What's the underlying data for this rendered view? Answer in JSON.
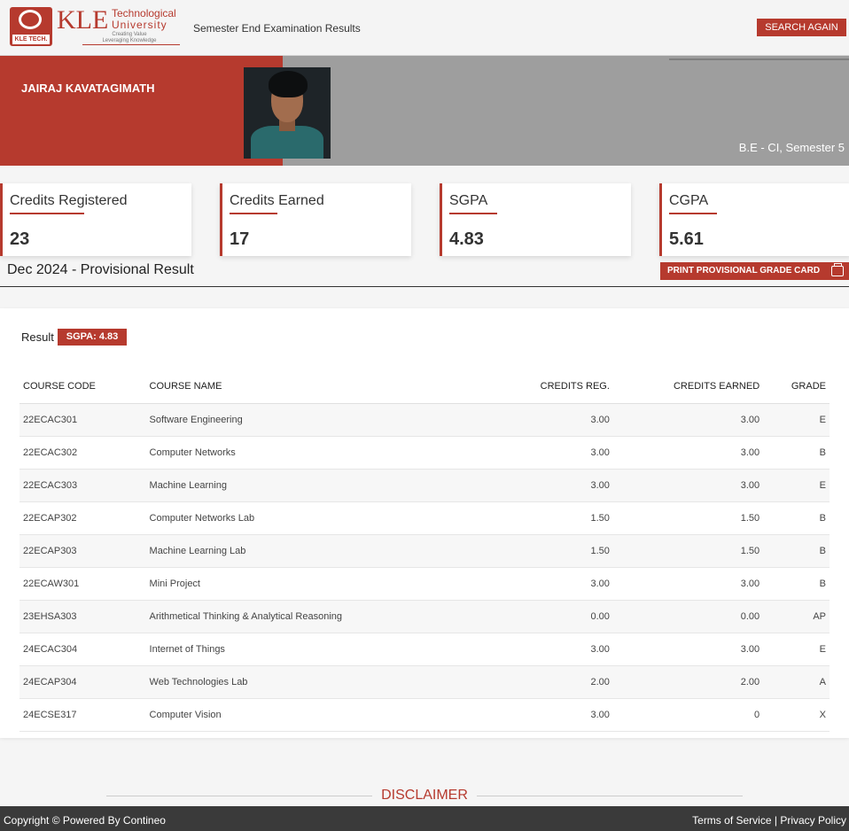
{
  "header": {
    "logo": {
      "name": "KLE",
      "subtitle_line1": "Technological",
      "subtitle_line2": "University",
      "tagline_line1": "Creating Value",
      "tagline_line2": "Leveraging Knowledge",
      "badge": "KLE TECH."
    },
    "title": "Semester End Examination Results",
    "search_again_label": "SEARCH AGAIN"
  },
  "student": {
    "name": "JAIRAJ KAVATAGIMATH",
    "program": "B.E - CI, Semester 5"
  },
  "stats": [
    {
      "label": "Credits Registered",
      "value": "23"
    },
    {
      "label": "Credits Earned",
      "value": "17"
    },
    {
      "label": "SGPA",
      "value": "4.83"
    },
    {
      "label": "CGPA",
      "value": "5.61"
    }
  ],
  "result_title": "Dec 2024 - Provisional Result",
  "print_label": "PRINT PROVISIONAL GRADE CARD",
  "result": {
    "label": "Result",
    "sgpa_badge": "SGPA: 4.83",
    "columns": [
      "COURSE CODE",
      "COURSE NAME",
      "CREDITS REG.",
      "CREDITS EARNED",
      "GRADE"
    ],
    "rows": [
      {
        "code": "22ECAC301",
        "name": "Software Engineering",
        "reg": "3.00",
        "earned": "3.00",
        "grade": "E"
      },
      {
        "code": "22ECAC302",
        "name": "Computer Networks",
        "reg": "3.00",
        "earned": "3.00",
        "grade": "B"
      },
      {
        "code": "22ECAC303",
        "name": "Machine Learning",
        "reg": "3.00",
        "earned": "3.00",
        "grade": "E"
      },
      {
        "code": "22ECAP302",
        "name": "Computer Networks Lab",
        "reg": "1.50",
        "earned": "1.50",
        "grade": "B"
      },
      {
        "code": "22ECAP303",
        "name": "Machine Learning Lab",
        "reg": "1.50",
        "earned": "1.50",
        "grade": "B"
      },
      {
        "code": "22ECAW301",
        "name": "Mini Project",
        "reg": "3.00",
        "earned": "3.00",
        "grade": "B"
      },
      {
        "code": "23EHSA303",
        "name": "Arithmetical Thinking & Analytical Reasoning",
        "reg": "0.00",
        "earned": "0.00",
        "grade": "AP"
      },
      {
        "code": "24ECAC304",
        "name": "Internet of Things",
        "reg": "3.00",
        "earned": "3.00",
        "grade": "E"
      },
      {
        "code": "24ECAP304",
        "name": "Web Technologies Lab",
        "reg": "2.00",
        "earned": "2.00",
        "grade": "A"
      },
      {
        "code": "24ECSE317",
        "name": "Computer Vision",
        "reg": "3.00",
        "earned": "0",
        "grade": "X"
      }
    ]
  },
  "disclaimer": "DISCLAIMER",
  "footer": {
    "copyright": "Copyright © Powered By Contineo",
    "terms": "Terms of Service",
    "separator": "|",
    "privacy": "Privacy Policy"
  },
  "colors": {
    "accent": "#b63a2e",
    "banner_grey": "#9e9e9e",
    "footer": "#3a3a3a"
  },
  "icons": [
    "kle-logo-icon",
    "printer-icon"
  ]
}
